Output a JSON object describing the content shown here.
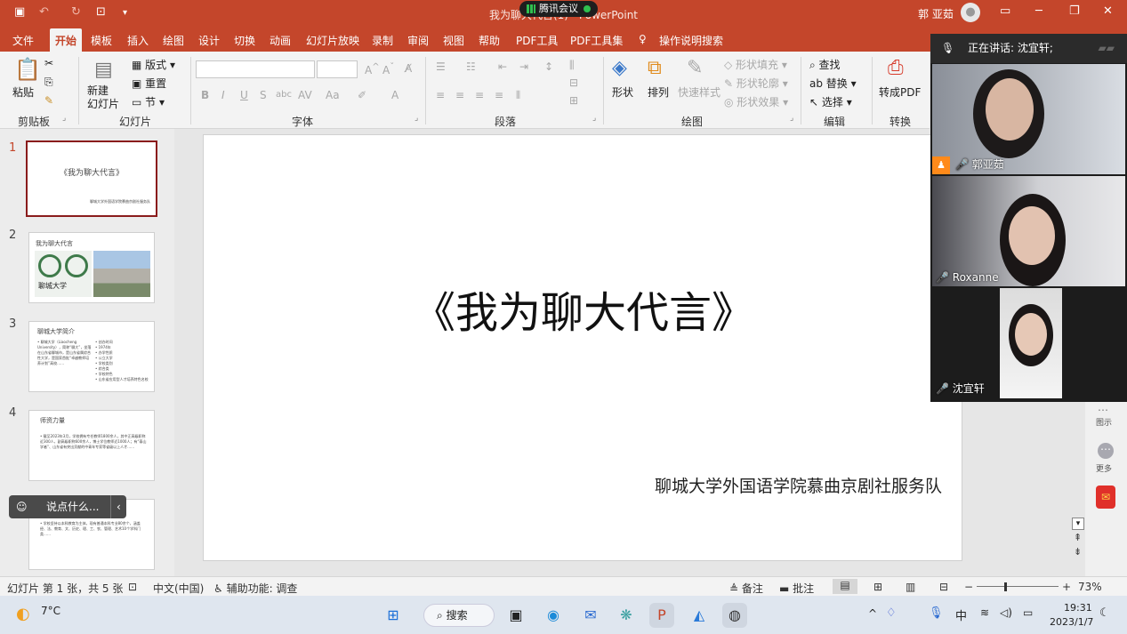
{
  "window": {
    "doc_title": "我为聊大代言(1) - PowerPoint",
    "meeting_app": "腾讯会议",
    "user_name": "郭 亚茹"
  },
  "tabs": [
    "文件",
    "开始",
    "插入",
    "绘图",
    "设计",
    "切换",
    "动画",
    "幻灯片放映",
    "录制",
    "审阅",
    "视图",
    "帮助",
    "PDF工具",
    "PDF工具集",
    "操作说明搜索"
  ],
  "tabs_extra": {
    "template": "模板"
  },
  "active_tab": "开始",
  "ribbon": {
    "paste": "粘贴",
    "new_slide": "新建\n幻灯片",
    "layout": "版式",
    "reset": "重置",
    "section": "节",
    "shape": "形状",
    "arrange": "排列",
    "quick_style": "快速样式",
    "shape_fill": "形状填充",
    "shape_outline": "形状轮廓",
    "shape_effect": "形状效果",
    "find": "查找",
    "replace": "替换",
    "select": "选择",
    "to_pdf": "转成PDF",
    "groups": {
      "clipboard": "剪贴板",
      "slides": "幻灯片",
      "font": "字体",
      "paragraph": "段落",
      "drawing": "绘图",
      "editing": "编辑",
      "convert": "转换"
    }
  },
  "thumbnails": [
    {
      "num": "1",
      "title": "《我为聊大代言》",
      "subtitle": "聊城大学外国语学院慕曲京剧社服务队"
    },
    {
      "num": "2",
      "title": "我为聊大代言",
      "logo_text": "聊城大学"
    },
    {
      "num": "3",
      "title": "聊城大学简介",
      "col1": "• 聊城大学（Liaocheng University），简称“聊大”，坐落在山东省聊城市，是山东省属综合性大学，是国家首批“卓越教师培养计划”高校……",
      "col2": "• 创办时间\n• 1974年\n• 办学性质\n• 公立大学\n• 学校类别\n• 综合类\n• 学校特色\n• 山东省应用型人才培养特色名校"
    },
    {
      "num": "4",
      "title": "师资力量",
      "body": "• 截至2023年3月，学校拥有专任教师1800余人，其中正高级职称近300人，副高级职称600余人，博士学位教师近1000人；有“泰山学者”、山东省有突出贡献的中青年专家等省级以上人才……"
    },
    {
      "num": "5",
      "title": "",
      "body": "• 学校坚持以本科教育为主体，现有普通本科专业80余个，涵盖经、法、教育、文、历史、理、工、农、管理、艺术10个学科门类……"
    }
  ],
  "slide": {
    "title": "《我为聊大代言》",
    "subtitle": "聊城大学外国语学院慕曲京剧社服务队"
  },
  "comment_prompt": "说点什么...",
  "meeting": {
    "speaking": "正在讲话: 沈宜轩;",
    "participants": [
      {
        "name": "郭亚茹"
      },
      {
        "name": "Roxanne"
      },
      {
        "name": "沈宜轩"
      }
    ]
  },
  "right_tools": {
    "view": "图示",
    "more": "更多"
  },
  "status": {
    "slide_info": "幻灯片 第 1 张，共 5 张",
    "language": "中文(中国)",
    "accessibility": "辅助功能: 调查",
    "notes": "备注",
    "comments": "批注",
    "zoom": "73%"
  },
  "taskbar": {
    "temp": "7°C",
    "search": "搜索",
    "ime": "中",
    "time": "19:31",
    "date": "2023/1/7"
  },
  "colors": {
    "accent": "#c4462b",
    "thumb_selected": "#8a1c1c"
  }
}
